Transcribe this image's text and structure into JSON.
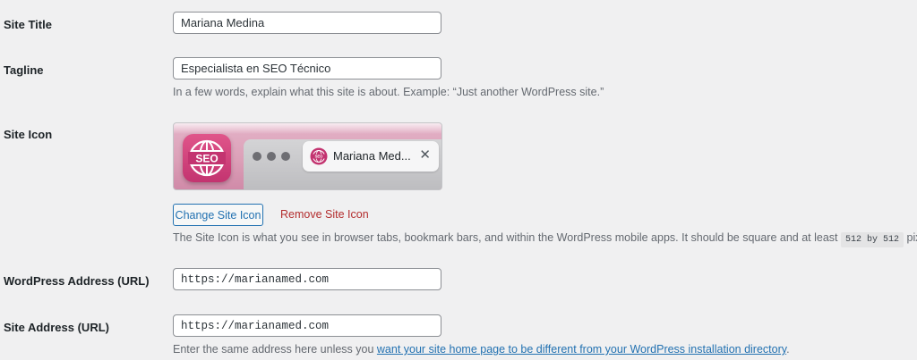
{
  "settings": {
    "site_title": {
      "label": "Site Title",
      "value": "Mariana Medina"
    },
    "tagline": {
      "label": "Tagline",
      "value": "Especialista en SEO Técnico",
      "description": "In a few words, explain what this site is about. Example: “Just another WordPress site.”"
    },
    "site_icon": {
      "label": "Site Icon",
      "app_icon_text": "SEO",
      "tab_title": "Mariana Med...",
      "tab_close": "✕",
      "change_button": "Change Site Icon",
      "remove_link": "Remove Site Icon",
      "description_before": "The Site Icon is what you see in browser tabs, bookmark bars, and within the WordPress mobile apps. It should be square and at least ",
      "description_code": "512 by 512",
      "description_after": " pixels."
    },
    "wordpress_address": {
      "label": "WordPress Address (URL)",
      "value": "https://marianamed.com"
    },
    "site_address": {
      "label": "Site Address (URL)",
      "value": "https://marianamed.com",
      "description_before": "Enter the same address here unless you ",
      "description_link": "want your site home page to be different from your WordPress installation directory",
      "description_after": "."
    }
  },
  "colors": {
    "link": "#2271b1",
    "danger": "#b32d2e",
    "icon_pink": "#c33470"
  }
}
